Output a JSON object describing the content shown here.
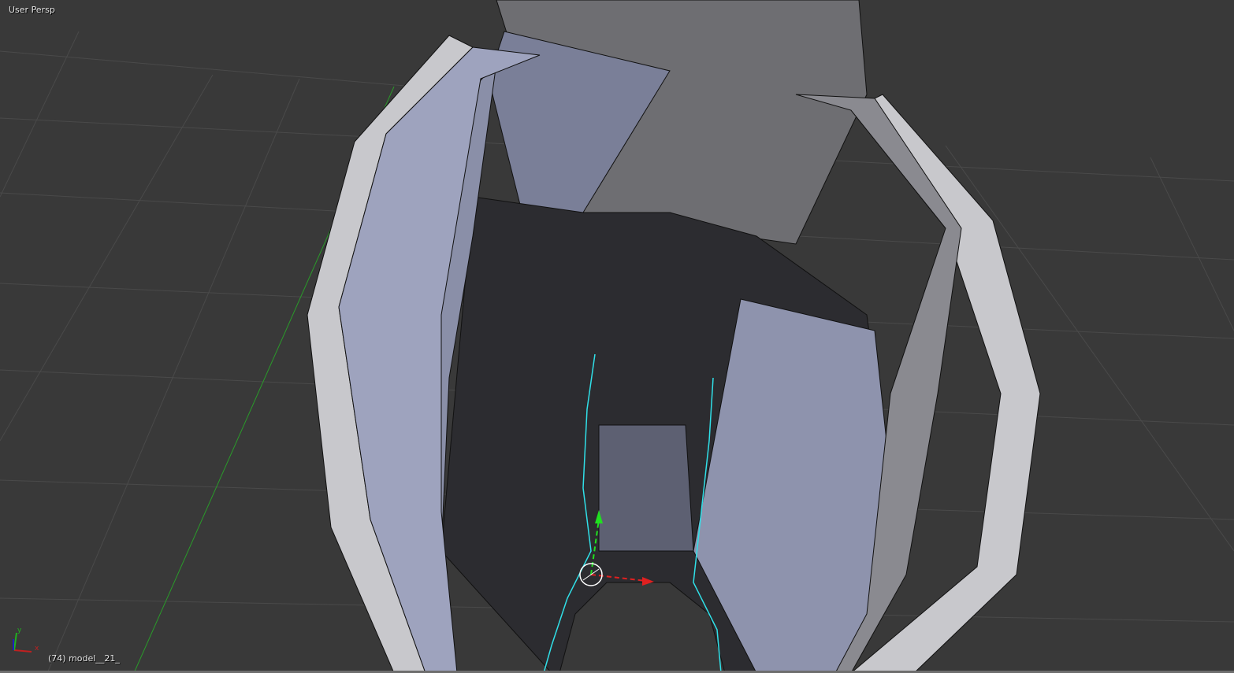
{
  "viewport": {
    "view_name": "User Persp",
    "object_info": "(74) model__21_",
    "axes": {
      "x_label": "x",
      "y_label": "y"
    }
  },
  "colors": {
    "background": "#393939",
    "grid": "#4a4a4a",
    "x_axis": "#b02020",
    "y_axis": "#2a9a2a",
    "mesh_light": "#9aa0b8",
    "mesh_dark": "#2a2a2e",
    "selection": "#30e0e8"
  }
}
